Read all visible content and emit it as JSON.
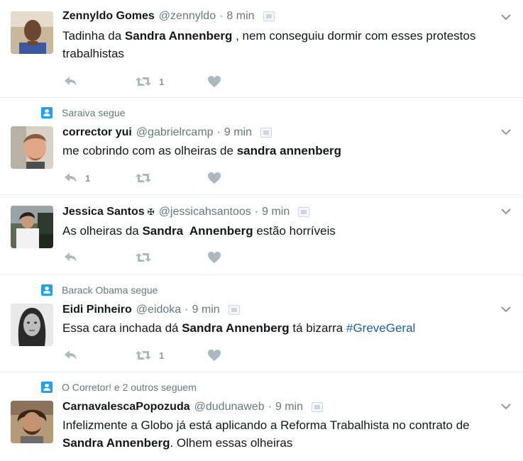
{
  "tweets": [
    {
      "social": "",
      "name": "Zennyldo Gomes",
      "handle": "@zennyldo",
      "time": "8 min",
      "flag": "",
      "text_parts": [
        "Tadinha da ",
        "Sandra Annenberg",
        " , nem conseguiu dormir com esses protestos trabalhistas"
      ],
      "reply_count": "",
      "retweet_count": "1",
      "like_count": ""
    },
    {
      "social": "Saraiva segue",
      "name": "corrector yui",
      "handle": "@gabrielrcamp",
      "time": "9 min",
      "flag": "",
      "text_parts": [
        "me cobrindo com as olheiras de ",
        "sandra annenberg",
        ""
      ],
      "reply_count": "1",
      "retweet_count": "",
      "like_count": ""
    },
    {
      "social": "",
      "name": "Jessica Santos",
      "handle": "@jessicahsantoos",
      "time": "9 min",
      "flag": "✠",
      "text_parts": [
        "As olheiras da ",
        "Sandra  Annenberg",
        " estão horríveis"
      ],
      "reply_count": "",
      "retweet_count": "",
      "like_count": ""
    },
    {
      "social": "Barack Obama segue",
      "name": "Eidi Pinheiro",
      "handle": "@eidoka",
      "time": "9 min",
      "flag": "",
      "text_parts": [
        "Essa cara inchada dá ",
        "Sandra Annenberg",
        " tá bizarra "
      ],
      "hashtag": "#GreveGeral",
      "reply_count": "",
      "retweet_count": "1",
      "like_count": ""
    },
    {
      "social": "O Corretor! e 2 outros seguem",
      "name": "CarnavalescaPopozuda",
      "handle": "@dudunaweb",
      "time": "9 min",
      "flag": "",
      "text_parts": [
        "Infelizmente a Globo já está aplicando a Reforma Trabalhista no contrato de ",
        "Sandra Annenberg",
        ". Olhem essas olheiras"
      ]
    }
  ],
  "icons": {
    "reply": "reply-icon",
    "retweet": "retweet-icon",
    "like": "heart-icon",
    "caret": "chevron-down-icon",
    "translate": "translate-icon",
    "social_context": "person-icon"
  },
  "colors": {
    "action_gray": "#aab8c2",
    "hashtag_blue": "#1b5fa8",
    "social_blue": "#1da1f2",
    "muted_text": "#657786"
  }
}
